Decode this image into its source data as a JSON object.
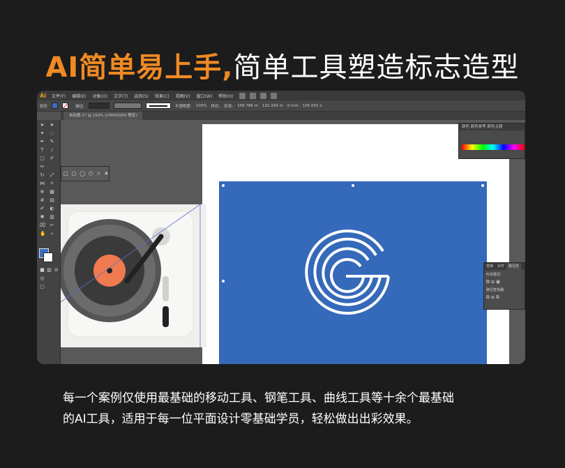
{
  "headline": {
    "accent": "AI简单易上手,",
    "rest": "简单工具塑造标志造型"
  },
  "app": {
    "logo": "Ai",
    "menu": [
      "文件(F)",
      "编辑(E)",
      "对象(O)",
      "文字(T)",
      "选择(S)",
      "效果(C)",
      "视图(V)",
      "窗口(W)",
      "帮助(H)"
    ],
    "control": {
      "object_type": "矩形",
      "stroke_label": "描边:",
      "opacity_label": "不透明度:",
      "opacity_value": "100%",
      "style_label": "样式:",
      "shape_label": "形状:",
      "width_value": "156.786 m",
      "height_value": "120.164 m",
      "corner_value": "0 mm",
      "x_value": "105.001 n"
    },
    "tab": "未标题-1* @ 150% (CMYK/GPU 预览)",
    "color_panel": {
      "tab1": "颜色",
      "tab2": "颜色参考",
      "tab3": "颜色主题"
    },
    "pathfinder": {
      "tabs": [
        "变换",
        "对齐",
        "路径查"
      ],
      "row1_label": "形状模式:",
      "row2_label": "路径查找器:"
    },
    "colors": {
      "accent": "#f08a24",
      "blue": "#3569b9",
      "record_orange": "#f07a4f"
    }
  },
  "caption": {
    "line1": "每一个案例仅使用最基础的移动工具、钢笔工具、曲线工具等十余个最基础",
    "line2": "的AI工具，适用于每一位平面设计零基础学员，轻松做出出彩效果。"
  }
}
